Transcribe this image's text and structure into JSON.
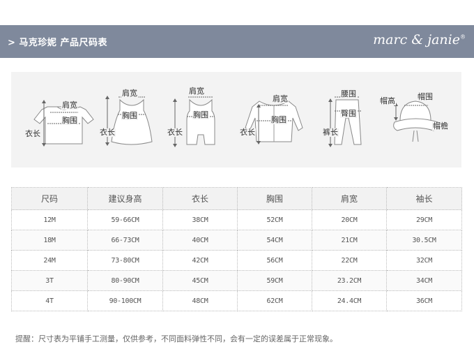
{
  "header": {
    "title": "> 马克珍妮  产品尺码表",
    "brand": "marc & janie",
    "brand_mark": "®",
    "colors": {
      "banner": "#7f899c",
      "text": "#ffffff"
    }
  },
  "diagrams": {
    "tshirt": {
      "shoulder": "肩宽",
      "chest": "胸围",
      "length": "衣长"
    },
    "dress": {
      "shoulder": "肩宽",
      "chest": "胸围",
      "length": "衣长"
    },
    "romper": {
      "shoulder": "肩宽",
      "chest": "胸围",
      "length": "衣长"
    },
    "jacket": {
      "shoulder": "肩宽",
      "chest": "胸围",
      "length": "衣长"
    },
    "pants": {
      "waist": "腰围",
      "hip": "臀围",
      "length": "裤长"
    },
    "hat": {
      "height": "帽高",
      "circumference": "帽围",
      "brim": "帽檐"
    }
  },
  "table": {
    "headers": [
      "尺码",
      "建议身高",
      "衣长",
      "胸围",
      "肩宽",
      "袖长"
    ],
    "rows": [
      [
        "12M",
        "59-66CM",
        "38CM",
        "52CM",
        "20CM",
        "29CM"
      ],
      [
        "18M",
        "66-73CM",
        "40CM",
        "54CM",
        "21CM",
        "30.5CM"
      ],
      [
        "24M",
        "73-80CM",
        "42CM",
        "56CM",
        "22CM",
        "32CM"
      ],
      [
        "3T",
        "80-90CM",
        "45CM",
        "59CM",
        "23.2CM",
        "34CM"
      ],
      [
        "4T",
        "90-100CM",
        "48CM",
        "62CM",
        "24.4CM",
        "36CM"
      ]
    ]
  },
  "note": "提醒：尺寸表为平铺手工测量，仅供参考，不同面料弹性不同，会有一定的误差属于正常现象。"
}
